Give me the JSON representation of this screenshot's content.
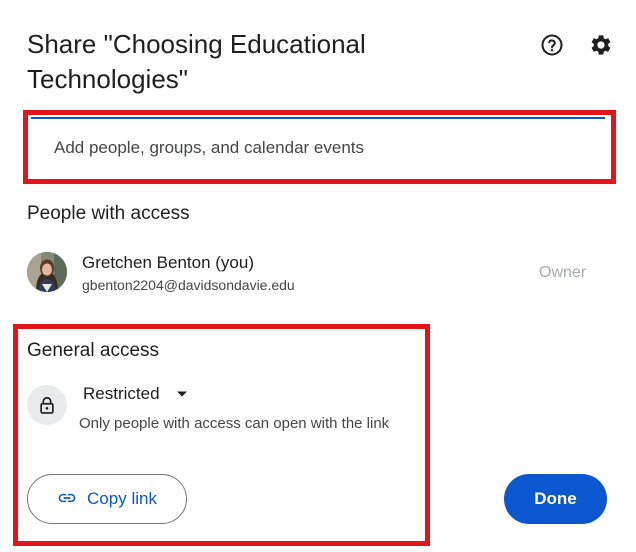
{
  "dialog": {
    "title": "Share \"Choosing Educational Technologies\"",
    "help_icon": "help-circle-icon",
    "settings_icon": "gear-icon"
  },
  "add_people": {
    "placeholder": "Add people, groups, and calendar events",
    "value": ""
  },
  "people_with_access": {
    "heading": "People with access",
    "people": [
      {
        "name": "Gretchen Benton (you)",
        "email": "gbenton2204@davidsondavie.edu",
        "role": "Owner",
        "avatar": "user-photo"
      }
    ]
  },
  "general_access": {
    "heading": "General access",
    "icon": "lock-icon",
    "selected": "Restricted",
    "description": "Only people with access can open with the link"
  },
  "actions": {
    "copy_link_label": "Copy link",
    "copy_link_icon": "link-icon",
    "done_label": "Done"
  },
  "colors": {
    "accent": "#0b57d0",
    "highlight": "#e0161b",
    "muted_text": "#444746",
    "role_text": "#a8abae"
  }
}
